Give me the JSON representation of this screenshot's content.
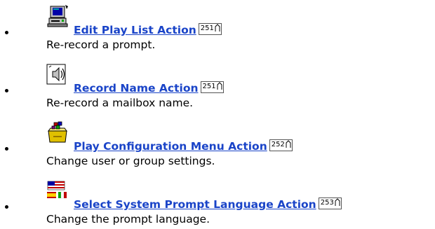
{
  "items": [
    {
      "icon": "computer-icon",
      "title": "Edit Play List Action",
      "page": "251",
      "description": "Re-record a prompt."
    },
    {
      "icon": "speaker-sound-icon",
      "title": "Record Name Action",
      "page": "251",
      "description": "Re-record a mailbox name."
    },
    {
      "icon": "package-config-icon",
      "title": "Play Configuration Menu Action",
      "page": "252",
      "description": "Change user or group settings."
    },
    {
      "icon": "flags-icon",
      "title": "Select System Prompt Language Action",
      "page": "253",
      "description": "Change the prompt language."
    }
  ],
  "colors": {
    "link": "#1a44c8",
    "text": "#000000"
  }
}
